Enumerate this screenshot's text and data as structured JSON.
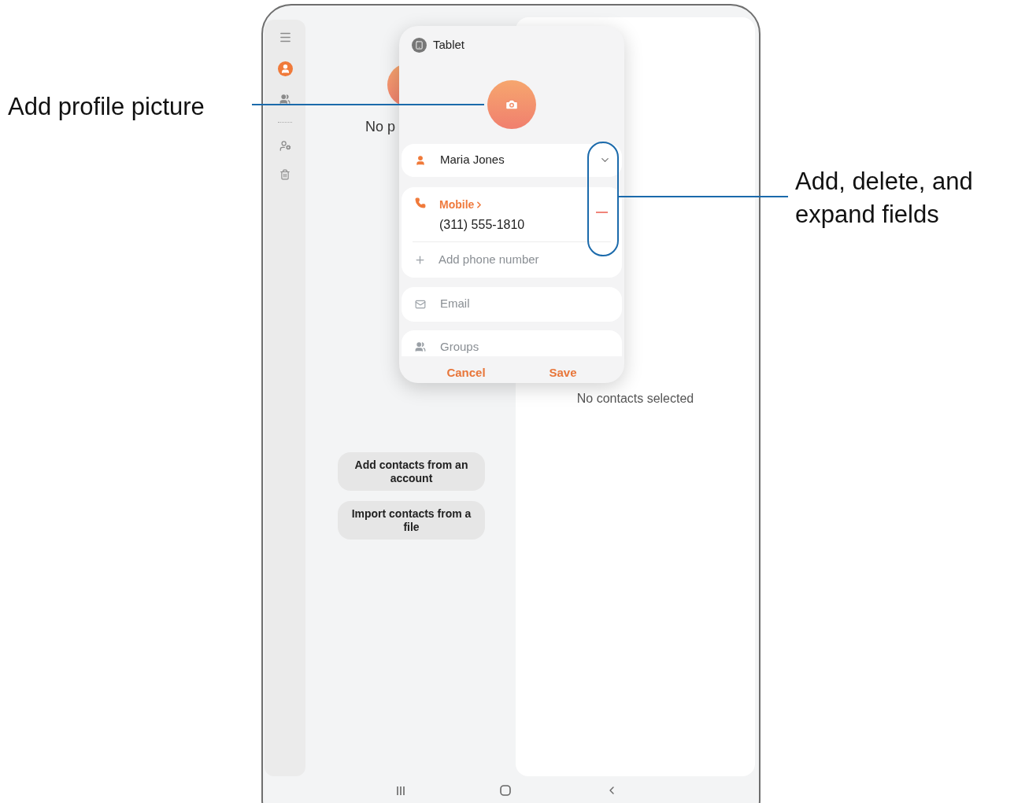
{
  "callouts": [
    {
      "text": "Add profile picture"
    },
    {
      "text": "Add, delete, and expand fields"
    }
  ],
  "sidebar": {
    "items": [
      {
        "kind": "menu",
        "selected": false
      },
      {
        "kind": "contacts",
        "selected": true
      },
      {
        "kind": "groups",
        "selected": false
      },
      {
        "kind": "divider",
        "selected": false
      },
      {
        "kind": "manage",
        "selected": false
      },
      {
        "kind": "trash",
        "selected": false
      }
    ]
  },
  "left_pane": {
    "empty_text": "No p",
    "buttons": [
      "Add contacts from an account",
      "Import contacts from a file"
    ]
  },
  "right_pane": {
    "empty_text": "No contacts selected"
  },
  "dialog": {
    "storage": "Tablet",
    "name": "Maria Jones",
    "phone": {
      "label": "Mobile",
      "value": "(311) 555-1810"
    },
    "add_phone": "Add phone number",
    "fields": [
      {
        "kind": "email",
        "placeholder": "Email"
      },
      {
        "kind": "groups",
        "placeholder": "Groups"
      }
    ],
    "actions": [
      "Cancel",
      "Save"
    ]
  }
}
